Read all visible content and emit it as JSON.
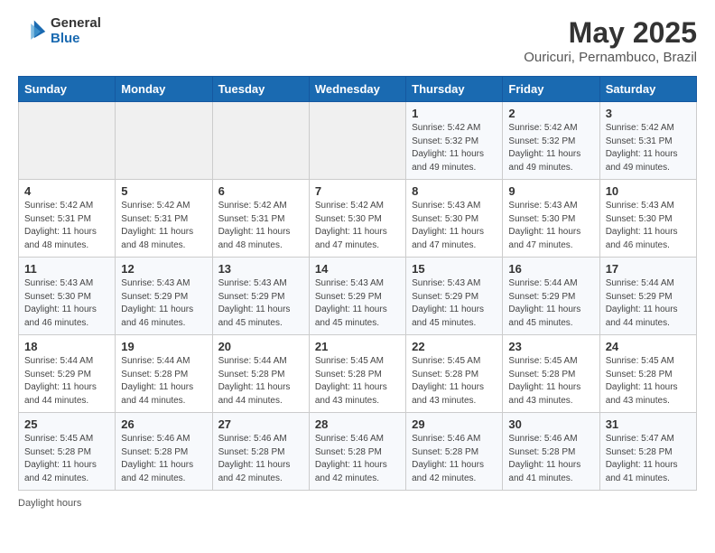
{
  "logo": {
    "general": "General",
    "blue": "Blue"
  },
  "title": "May 2025",
  "subtitle": "Ouricuri, Pernambuco, Brazil",
  "days_of_week": [
    "Sunday",
    "Monday",
    "Tuesday",
    "Wednesday",
    "Thursday",
    "Friday",
    "Saturday"
  ],
  "footer": "Daylight hours",
  "weeks": [
    [
      {
        "day": "",
        "info": ""
      },
      {
        "day": "",
        "info": ""
      },
      {
        "day": "",
        "info": ""
      },
      {
        "day": "",
        "info": ""
      },
      {
        "day": "1",
        "info": "Sunrise: 5:42 AM\nSunset: 5:32 PM\nDaylight: 11 hours and 49 minutes."
      },
      {
        "day": "2",
        "info": "Sunrise: 5:42 AM\nSunset: 5:32 PM\nDaylight: 11 hours and 49 minutes."
      },
      {
        "day": "3",
        "info": "Sunrise: 5:42 AM\nSunset: 5:31 PM\nDaylight: 11 hours and 49 minutes."
      }
    ],
    [
      {
        "day": "4",
        "info": "Sunrise: 5:42 AM\nSunset: 5:31 PM\nDaylight: 11 hours and 48 minutes."
      },
      {
        "day": "5",
        "info": "Sunrise: 5:42 AM\nSunset: 5:31 PM\nDaylight: 11 hours and 48 minutes."
      },
      {
        "day": "6",
        "info": "Sunrise: 5:42 AM\nSunset: 5:31 PM\nDaylight: 11 hours and 48 minutes."
      },
      {
        "day": "7",
        "info": "Sunrise: 5:42 AM\nSunset: 5:30 PM\nDaylight: 11 hours and 47 minutes."
      },
      {
        "day": "8",
        "info": "Sunrise: 5:43 AM\nSunset: 5:30 PM\nDaylight: 11 hours and 47 minutes."
      },
      {
        "day": "9",
        "info": "Sunrise: 5:43 AM\nSunset: 5:30 PM\nDaylight: 11 hours and 47 minutes."
      },
      {
        "day": "10",
        "info": "Sunrise: 5:43 AM\nSunset: 5:30 PM\nDaylight: 11 hours and 46 minutes."
      }
    ],
    [
      {
        "day": "11",
        "info": "Sunrise: 5:43 AM\nSunset: 5:30 PM\nDaylight: 11 hours and 46 minutes."
      },
      {
        "day": "12",
        "info": "Sunrise: 5:43 AM\nSunset: 5:29 PM\nDaylight: 11 hours and 46 minutes."
      },
      {
        "day": "13",
        "info": "Sunrise: 5:43 AM\nSunset: 5:29 PM\nDaylight: 11 hours and 45 minutes."
      },
      {
        "day": "14",
        "info": "Sunrise: 5:43 AM\nSunset: 5:29 PM\nDaylight: 11 hours and 45 minutes."
      },
      {
        "day": "15",
        "info": "Sunrise: 5:43 AM\nSunset: 5:29 PM\nDaylight: 11 hours and 45 minutes."
      },
      {
        "day": "16",
        "info": "Sunrise: 5:44 AM\nSunset: 5:29 PM\nDaylight: 11 hours and 45 minutes."
      },
      {
        "day": "17",
        "info": "Sunrise: 5:44 AM\nSunset: 5:29 PM\nDaylight: 11 hours and 44 minutes."
      }
    ],
    [
      {
        "day": "18",
        "info": "Sunrise: 5:44 AM\nSunset: 5:29 PM\nDaylight: 11 hours and 44 minutes."
      },
      {
        "day": "19",
        "info": "Sunrise: 5:44 AM\nSunset: 5:28 PM\nDaylight: 11 hours and 44 minutes."
      },
      {
        "day": "20",
        "info": "Sunrise: 5:44 AM\nSunset: 5:28 PM\nDaylight: 11 hours and 44 minutes."
      },
      {
        "day": "21",
        "info": "Sunrise: 5:45 AM\nSunset: 5:28 PM\nDaylight: 11 hours and 43 minutes."
      },
      {
        "day": "22",
        "info": "Sunrise: 5:45 AM\nSunset: 5:28 PM\nDaylight: 11 hours and 43 minutes."
      },
      {
        "day": "23",
        "info": "Sunrise: 5:45 AM\nSunset: 5:28 PM\nDaylight: 11 hours and 43 minutes."
      },
      {
        "day": "24",
        "info": "Sunrise: 5:45 AM\nSunset: 5:28 PM\nDaylight: 11 hours and 43 minutes."
      }
    ],
    [
      {
        "day": "25",
        "info": "Sunrise: 5:45 AM\nSunset: 5:28 PM\nDaylight: 11 hours and 42 minutes."
      },
      {
        "day": "26",
        "info": "Sunrise: 5:46 AM\nSunset: 5:28 PM\nDaylight: 11 hours and 42 minutes."
      },
      {
        "day": "27",
        "info": "Sunrise: 5:46 AM\nSunset: 5:28 PM\nDaylight: 11 hours and 42 minutes."
      },
      {
        "day": "28",
        "info": "Sunrise: 5:46 AM\nSunset: 5:28 PM\nDaylight: 11 hours and 42 minutes."
      },
      {
        "day": "29",
        "info": "Sunrise: 5:46 AM\nSunset: 5:28 PM\nDaylight: 11 hours and 42 minutes."
      },
      {
        "day": "30",
        "info": "Sunrise: 5:46 AM\nSunset: 5:28 PM\nDaylight: 11 hours and 41 minutes."
      },
      {
        "day": "31",
        "info": "Sunrise: 5:47 AM\nSunset: 5:28 PM\nDaylight: 11 hours and 41 minutes."
      }
    ]
  ]
}
